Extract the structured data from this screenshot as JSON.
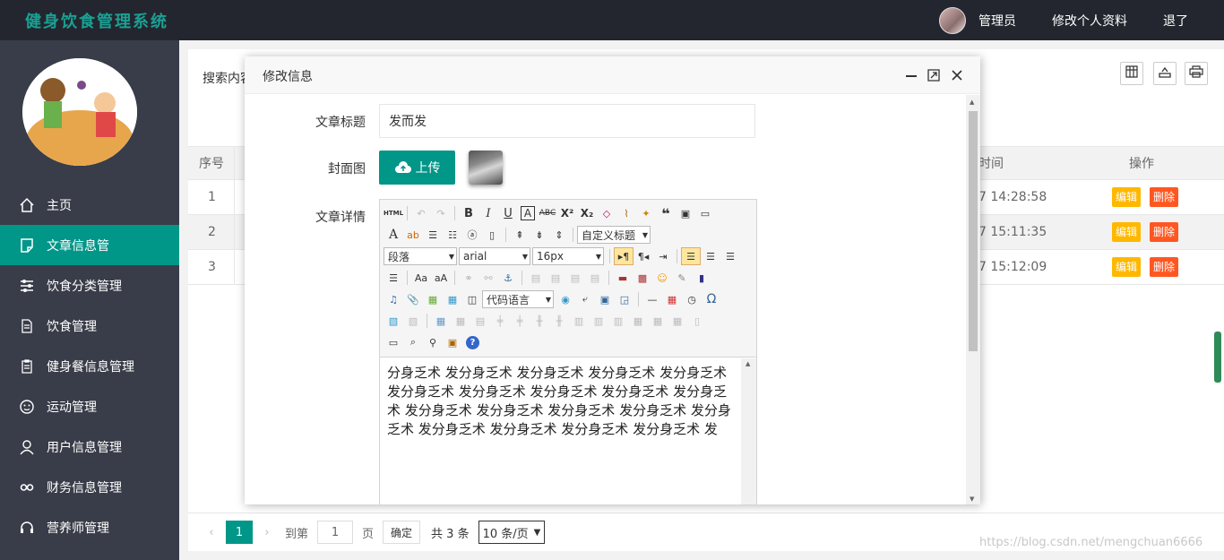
{
  "header": {
    "app_title": "健身饮食管理系统",
    "user_label": "管理员",
    "edit_profile": "修改个人资料",
    "logout": "退了"
  },
  "sidebar": {
    "items": [
      {
        "label": "主页",
        "icon": "home-icon"
      },
      {
        "label": "文章信息管",
        "icon": "note-icon",
        "active": true
      },
      {
        "label": "饮食分类管理",
        "icon": "sliders-icon"
      },
      {
        "label": "饮食管理",
        "icon": "document-icon"
      },
      {
        "label": "健身餐信息管理",
        "icon": "clipboard-icon"
      },
      {
        "label": "运动管理",
        "icon": "face-icon"
      },
      {
        "label": "用户信息管理",
        "icon": "user-icon"
      },
      {
        "label": "财务信息管理",
        "icon": "link-icon"
      },
      {
        "label": "营养师管理",
        "icon": "headset-icon"
      }
    ]
  },
  "main": {
    "search_label": "搜索内容",
    "table": {
      "headers": {
        "index": "序号",
        "time": "时间",
        "actions": "操作"
      },
      "rows": [
        {
          "index": "1",
          "time": "7 14:28:58"
        },
        {
          "index": "2",
          "time": "7 15:11:35"
        },
        {
          "index": "3",
          "time": "7 15:12:09"
        }
      ],
      "edit_label": "编辑",
      "delete_label": "删除"
    },
    "pager": {
      "current": "1",
      "goto_label": "到第",
      "page_input": "1",
      "page_unit": "页",
      "confirm": "确定",
      "total": "共 3 条",
      "page_size": "10 条/页"
    }
  },
  "modal": {
    "title": "修改信息",
    "fields": {
      "title_label": "文章标题",
      "title_value": "发而发",
      "cover_label": "封面图",
      "upload_label": "上传",
      "detail_label": "文章详情"
    },
    "editor": {
      "html_btn": "HTML",
      "custom_heading": "自定义标题",
      "paragraph": "段落",
      "font": "arial",
      "size": "16px",
      "code_lang": "代码语言",
      "content": "分身乏术 发分身乏术 发分身乏术 发分身乏术 发分身乏术 发分身乏术 发分身乏术 发分身乏术 发分身乏术 发分身乏术 发分身乏术 发分身乏术 发分身乏术 发分身乏术 发分身乏术 发分身乏术 发分身乏术 发分身乏术 发分身乏术 发"
    }
  },
  "watermark": "https://blog.csdn.net/mengchuan6666",
  "colors": {
    "accent": "#009688",
    "header": "#23262e",
    "sidebar": "#393d49",
    "edit": "#ffb800",
    "delete": "#ff5722"
  }
}
